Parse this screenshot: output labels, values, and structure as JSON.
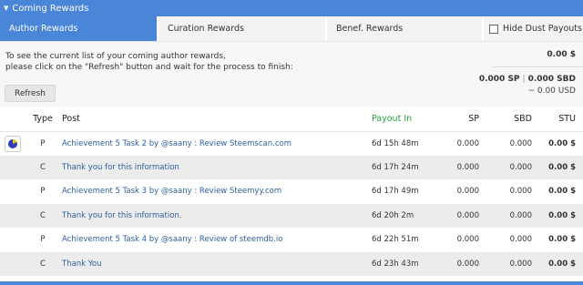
{
  "header": {
    "title": "Coming Rewards"
  },
  "tabs": [
    {
      "label": "Author Rewards",
      "active": true
    },
    {
      "label": "Curation Rewards",
      "active": false
    },
    {
      "label": "Benef. Rewards",
      "active": false
    }
  ],
  "hide_dust": {
    "label": "Hide Dust Payouts",
    "checked": false
  },
  "info": {
    "line1": "To see the current list of your coming author rewards,",
    "line2": "please click on the \"Refresh\" button and wait for the process to finish:",
    "refresh_label": "Refresh"
  },
  "totals": {
    "usd": "0.00 $",
    "sp": "0.000 SP",
    "separator": "|",
    "sbd": "0.000 SBD",
    "conversion": "~ 0.00 USD"
  },
  "table": {
    "headers": {
      "type": "Type",
      "post": "Post",
      "payout": "Payout In",
      "sp": "SP",
      "sbd": "SBD",
      "stu": "STU"
    },
    "rows": [
      {
        "type": "P",
        "post": "Achievement 5 Task 2 by @saany : Review Steemscan.com",
        "payout": "6d 15h 48m",
        "sp": "0.000",
        "sbd": "0.000",
        "stu": "0.00 $",
        "icon": "pie-chart-icon"
      },
      {
        "type": "C",
        "post": "Thank you for this information",
        "payout": "6d 17h 24m",
        "sp": "0.000",
        "sbd": "0.000",
        "stu": "0.00 $"
      },
      {
        "type": "P",
        "post": "Achievement 5 Task 3 by @saany : Review Steemyy.com",
        "payout": "6d 17h 49m",
        "sp": "0.000",
        "sbd": "0.000",
        "stu": "0.00 $"
      },
      {
        "type": "C",
        "post": "Thank you for this information.",
        "payout": "6d 20h 2m",
        "sp": "0.000",
        "sbd": "0.000",
        "stu": "0.00 $"
      },
      {
        "type": "P",
        "post": "Achievement 5 Task 4 by @saany : Review of steemdb.io",
        "payout": "6d 22h 51m",
        "sp": "0.000",
        "sbd": "0.000",
        "stu": "0.00 $"
      },
      {
        "type": "C",
        "post": "Thank You",
        "payout": "6d 23h 43m",
        "sp": "0.000",
        "sbd": "0.000",
        "stu": "0.00 $"
      }
    ]
  },
  "colors": {
    "accent": "#4a86d8",
    "payout_header": "#27a33b",
    "link": "#2d5f9e"
  }
}
